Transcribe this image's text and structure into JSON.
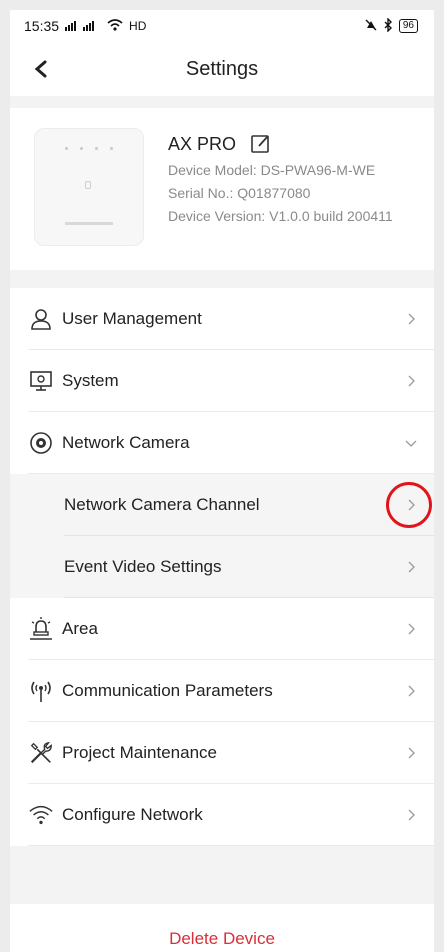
{
  "status_bar": {
    "time": "15:35",
    "signals": "4G 4G",
    "network": "HD",
    "battery": "96"
  },
  "header": {
    "title": "Settings",
    "back_icon": "chevron-left-icon"
  },
  "device": {
    "name": "AX PRO",
    "model_line": "Device Model: DS-PWA96-M-WE",
    "serial_line": "Serial No.: Q01877080",
    "version_line": "Device Version: V1.0.0 build 200411"
  },
  "menu": {
    "items": [
      {
        "label": "User Management",
        "icon": "user-icon",
        "state": "collapsed"
      },
      {
        "label": "System",
        "icon": "system-icon",
        "state": "collapsed"
      },
      {
        "label": "Network Camera",
        "icon": "camera-icon",
        "state": "expanded"
      },
      {
        "label": "Network Camera Channel",
        "state": "sub",
        "highlighted": true
      },
      {
        "label": "Event Video Settings",
        "state": "sub"
      },
      {
        "label": "Area",
        "icon": "area-icon",
        "state": "collapsed"
      },
      {
        "label": "Communication Parameters",
        "icon": "antenna-icon",
        "state": "collapsed"
      },
      {
        "label": "Project Maintenance",
        "icon": "tools-icon",
        "state": "collapsed"
      },
      {
        "label": "Configure Network",
        "icon": "wifi-icon",
        "state": "collapsed"
      }
    ]
  },
  "delete_label": "Delete Device",
  "colors": {
    "accent_red": "#d7303a",
    "highlight_ring": "#e2141b",
    "text": "#222222",
    "muted": "#8a8a8a"
  }
}
